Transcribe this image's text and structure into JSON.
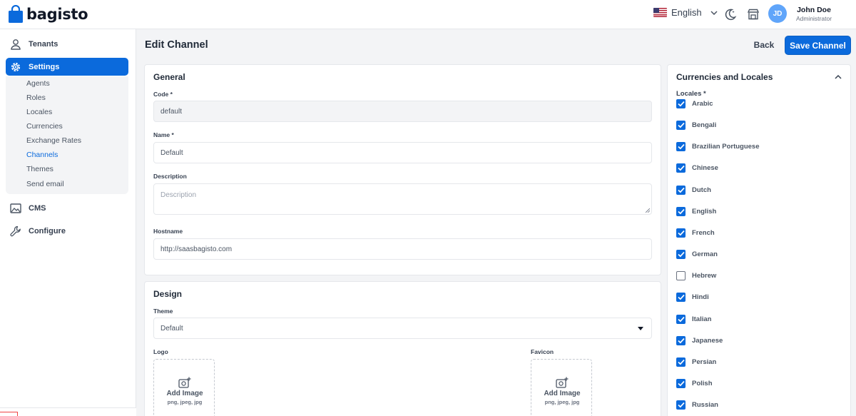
{
  "header": {
    "logo_text": "bagisto",
    "language": "English",
    "user_initials": "JD",
    "user_name": "John Doe",
    "user_role": "Administrator",
    "icons": [
      "flag-us-icon",
      "chevron-down-icon",
      "dark-mode-icon",
      "storefront-icon"
    ]
  },
  "sidebar": {
    "tenants": "Tenants",
    "settings": "Settings",
    "cms": "CMS",
    "configure": "Configure",
    "sub_items": [
      "Agents",
      "Roles",
      "Locales",
      "Currencies",
      "Exchange Rates",
      "Channels",
      "Themes",
      "Send email"
    ],
    "current_sub": "Channels"
  },
  "page": {
    "title": "Edit Channel",
    "back": "Back",
    "save": "Save Channel"
  },
  "general": {
    "title": "General",
    "code_label": "Code *",
    "code_value": "default",
    "name_label": "Name *",
    "name_value": "Default",
    "description_label": "Description",
    "description_placeholder": "Description",
    "hostname_label": "Hostname",
    "hostname_value": "http://saasbagisto.com"
  },
  "design": {
    "title": "Design",
    "theme_label": "Theme",
    "theme_value": "Default",
    "logo_label": "Logo",
    "favicon_label": "Favicon",
    "add_image": "Add Image",
    "formats": "png, jpeg, jpg"
  },
  "currencies_locales": {
    "title": "Currencies and Locales",
    "locales_label": "Locales *",
    "locales": [
      {
        "name": "Arabic",
        "checked": true
      },
      {
        "name": "Bengali",
        "checked": true
      },
      {
        "name": "Brazilian Portuguese",
        "checked": true
      },
      {
        "name": "Chinese",
        "checked": true
      },
      {
        "name": "Dutch",
        "checked": true
      },
      {
        "name": "English",
        "checked": true
      },
      {
        "name": "French",
        "checked": true
      },
      {
        "name": "German",
        "checked": true
      },
      {
        "name": "Hebrew",
        "checked": false
      },
      {
        "name": "Hindi",
        "checked": true
      },
      {
        "name": "Italian",
        "checked": true
      },
      {
        "name": "Japanese",
        "checked": true
      },
      {
        "name": "Persian",
        "checked": true
      },
      {
        "name": "Polish",
        "checked": true
      },
      {
        "name": "Russian",
        "checked": true
      }
    ]
  },
  "colors": {
    "primary": "#0b6adc",
    "avatar": "#60a5fa"
  }
}
